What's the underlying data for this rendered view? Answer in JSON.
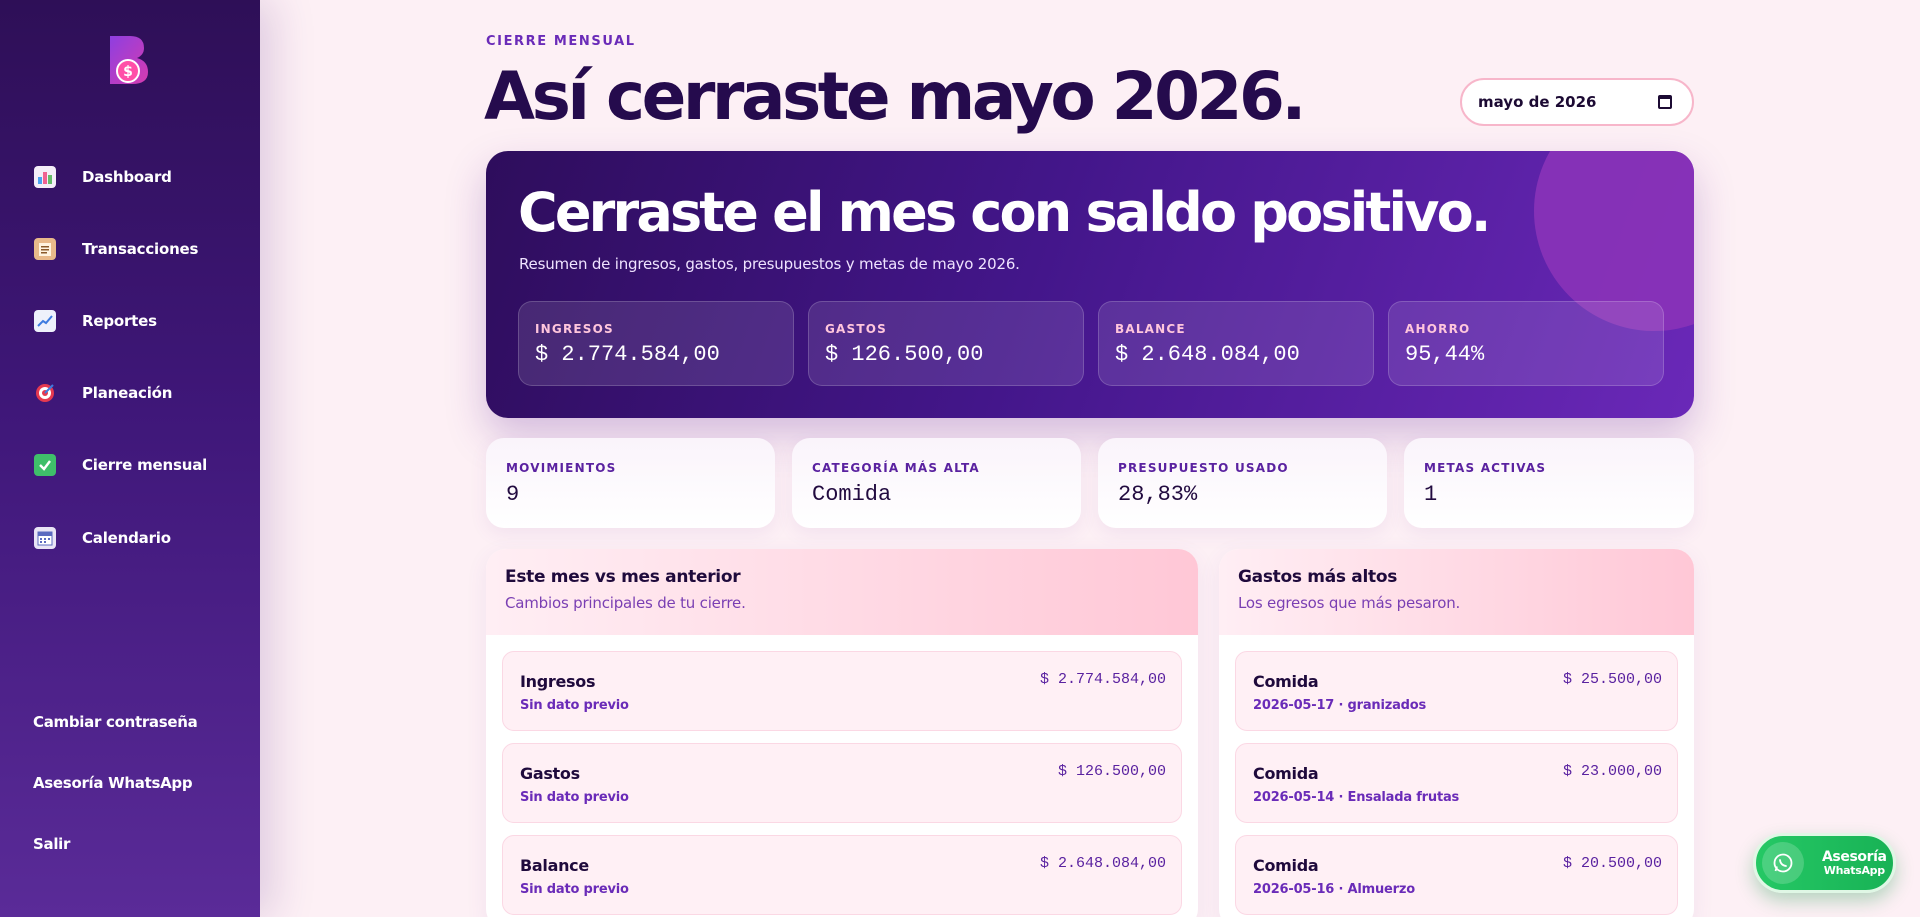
{
  "sidebar": {
    "items": [
      {
        "label": "Dashboard",
        "icon": "bar-chart-icon"
      },
      {
        "label": "Transacciones",
        "icon": "clipboard-icon"
      },
      {
        "label": "Reportes",
        "icon": "trend-chart-icon"
      },
      {
        "label": "Planeación",
        "icon": "target-icon"
      },
      {
        "label": "Cierre mensual",
        "icon": "check-box-icon"
      },
      {
        "label": "Calendario",
        "icon": "calendar-icon"
      }
    ],
    "bottom": {
      "change_password": "Cambiar contraseña",
      "whatsapp": "Asesoría WhatsApp",
      "logout": "Salir"
    }
  },
  "header": {
    "eyebrow": "CIERRE MENSUAL",
    "title": "Así cerraste mayo 2026.",
    "month_value": "mayo de 2026"
  },
  "hero": {
    "title": "Cerraste el mes con saldo positivo.",
    "subtitle": "Resumen de ingresos, gastos, presupuestos y metas de mayo 2026.",
    "kpis": [
      {
        "label": "INGRESOS",
        "value": "$ 2.774.584,00"
      },
      {
        "label": "GASTOS",
        "value": "$ 126.500,00"
      },
      {
        "label": "BALANCE",
        "value": "$ 2.648.084,00"
      },
      {
        "label": "AHORRO",
        "value": "95,44%"
      }
    ]
  },
  "stats": [
    {
      "label": "MOVIMIENTOS",
      "value": "9"
    },
    {
      "label": "CATEGORÍA MÁS ALTA",
      "value": "Comida"
    },
    {
      "label": "PRESUPUESTO USADO",
      "value": "28,83%"
    },
    {
      "label": "METAS ACTIVAS",
      "value": "1"
    }
  ],
  "comparison": {
    "title": "Este mes vs mes anterior",
    "subtitle": "Cambios principales de tu cierre.",
    "rows": [
      {
        "name": "Ingresos",
        "meta": "Sin dato previo",
        "amount": "$ 2.774.584,00"
      },
      {
        "name": "Gastos",
        "meta": "Sin dato previo",
        "amount": "$ 126.500,00"
      },
      {
        "name": "Balance",
        "meta": "Sin dato previo",
        "amount": "$ 2.648.084,00"
      }
    ]
  },
  "top_expenses": {
    "title": "Gastos más altos",
    "subtitle": "Los egresos que más pesaron.",
    "rows": [
      {
        "name": "Comida",
        "meta": "2026-05-17 · granizados",
        "amount": "$ 25.500,00"
      },
      {
        "name": "Comida",
        "meta": "2026-05-14 · Ensalada frutas",
        "amount": "$ 23.000,00"
      },
      {
        "name": "Comida",
        "meta": "2026-05-16 · Almuerzo",
        "amount": "$ 20.500,00"
      }
    ]
  },
  "whatsapp_button": {
    "line1": "Asesoría",
    "line2": "WhatsApp"
  },
  "colors": {
    "accent": "#6a2bb8",
    "sidebar": "#3f1779",
    "whatsapp": "#25c865"
  }
}
